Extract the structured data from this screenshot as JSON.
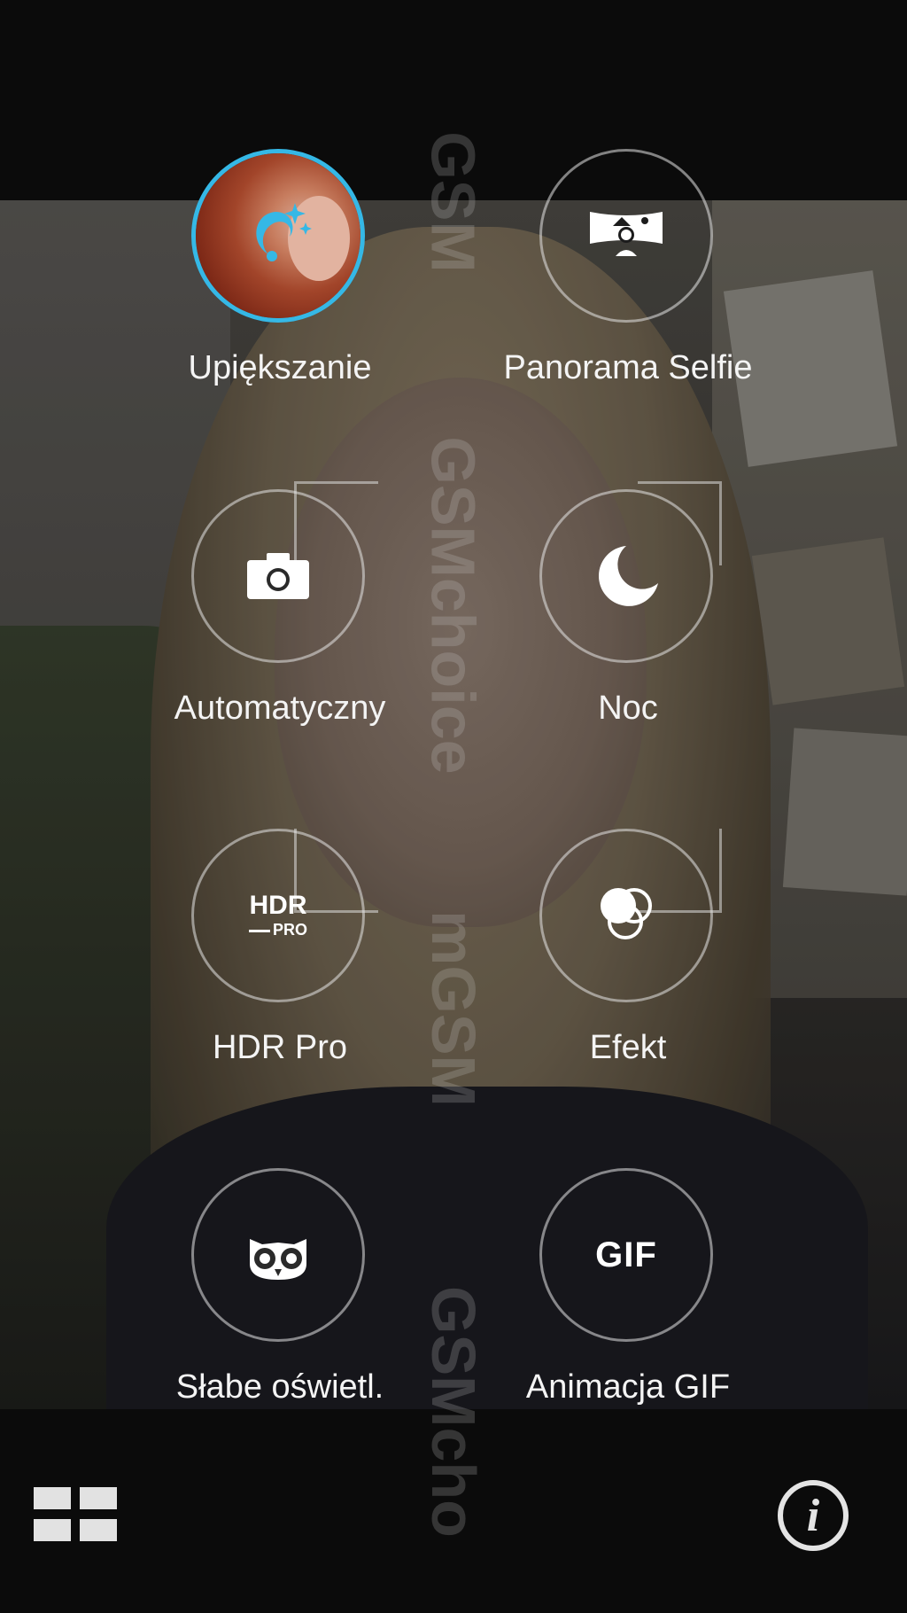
{
  "modes": [
    {
      "id": "beauty",
      "label": "Upiększanie",
      "icon": "beauty-face-icon",
      "selected": true
    },
    {
      "id": "panorama-selfie",
      "label": "Panorama Selfie",
      "icon": "panorama-selfie-icon",
      "selected": false
    },
    {
      "id": "auto",
      "label": "Automatyczny",
      "icon": "camera-icon",
      "selected": false
    },
    {
      "id": "night",
      "label": "Noc",
      "icon": "moon-icon",
      "selected": false
    },
    {
      "id": "hdr-pro",
      "label": "HDR Pro",
      "icon": "hdr-pro-icon",
      "icon_text": "HDR",
      "icon_subtext": "PRO",
      "selected": false
    },
    {
      "id": "effect",
      "label": "Efekt",
      "icon": "effect-circles-icon",
      "selected": false
    },
    {
      "id": "low-light",
      "label": "Słabe oświetl.",
      "icon": "owl-icon",
      "selected": false
    },
    {
      "id": "gif",
      "label": "Animacja GIF",
      "icon": "gif-icon",
      "icon_text": "GIF",
      "selected": false
    }
  ],
  "watermark": [
    "GSM",
    "GSMchoice",
    "mGSM",
    "GSMcho"
  ],
  "bottom_bar": {
    "left_icon": "grid-icon",
    "right_icon": "info-icon",
    "info_glyph": "i"
  },
  "colors": {
    "selected_ring": "#35b8e6",
    "ring": "#e6e6e6",
    "background": "#0b0b0b"
  }
}
